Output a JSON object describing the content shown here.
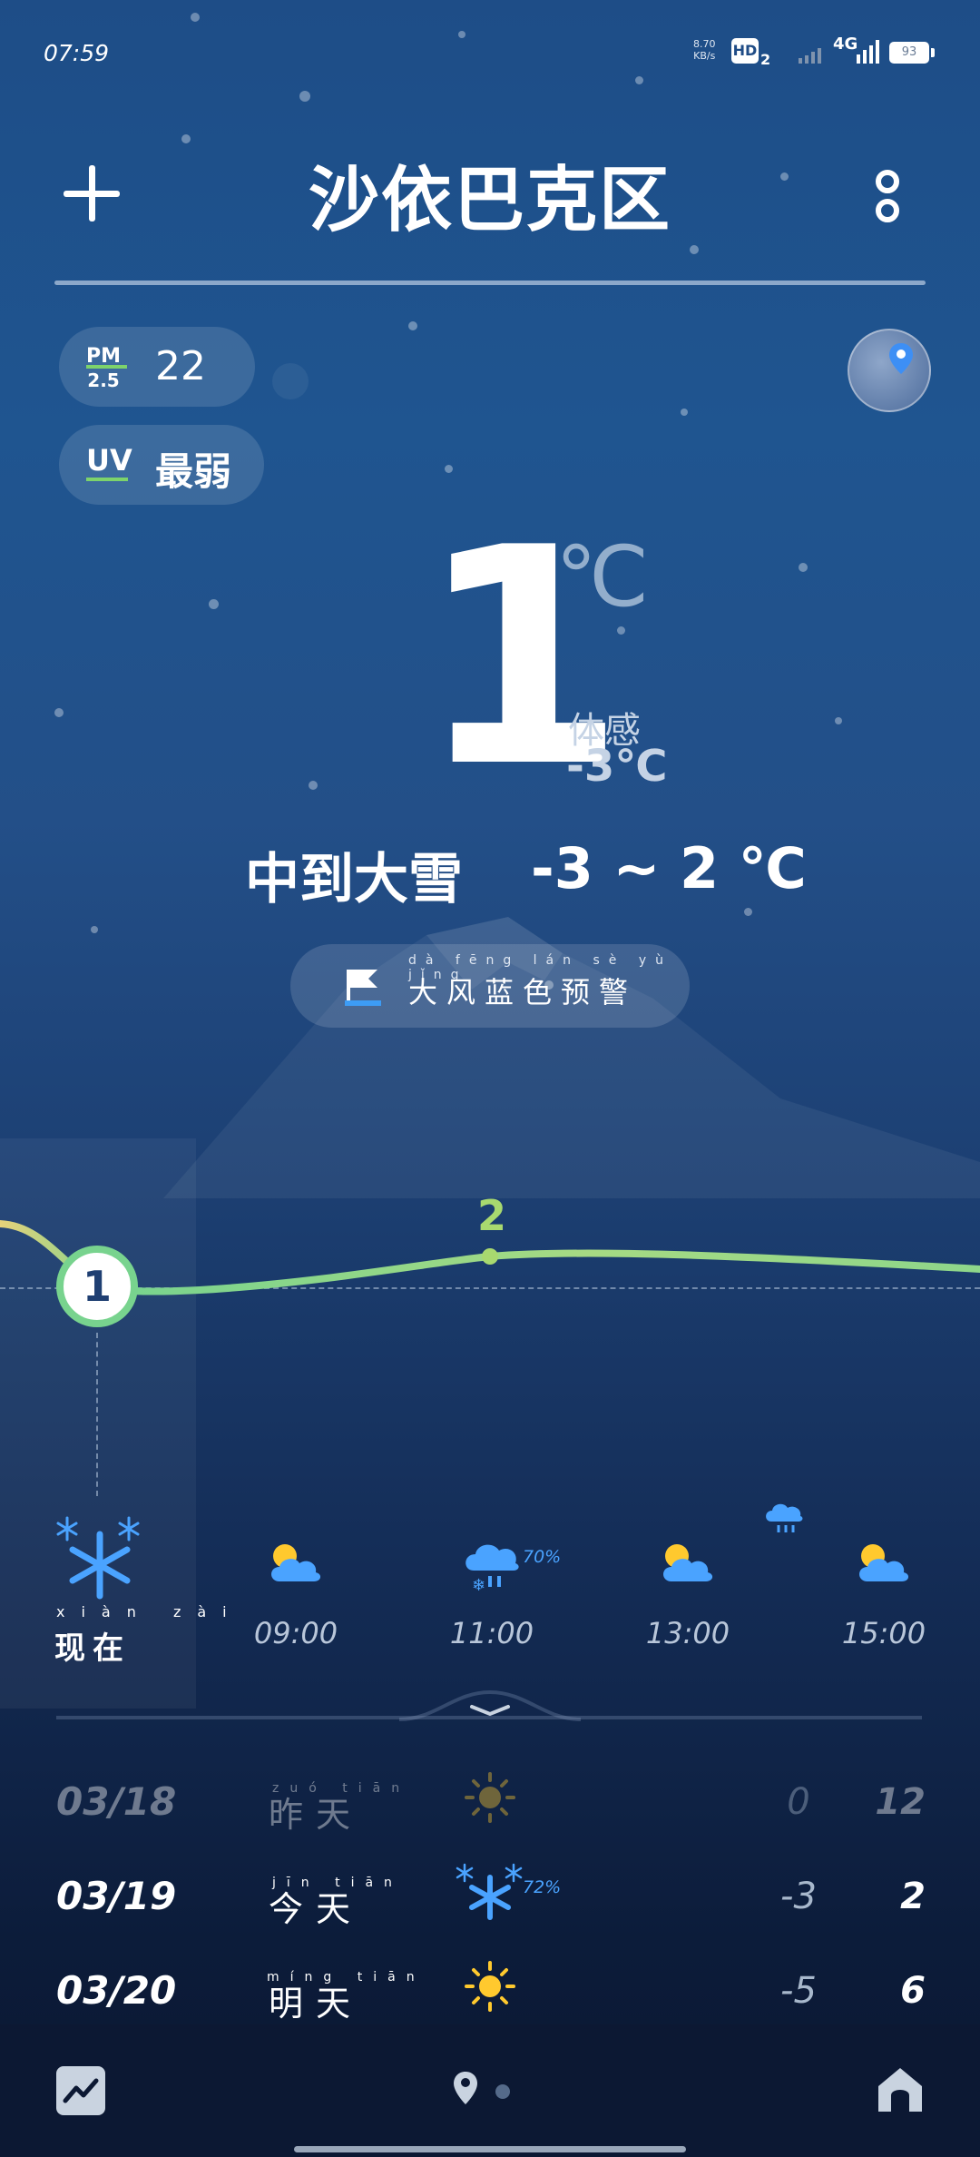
{
  "status_bar": {
    "time": "07:59",
    "net_speed_top": "8.70",
    "net_speed_unit": "KB/s",
    "hd": "HD",
    "hd_sub": "2",
    "network": "4G",
    "battery": "93"
  },
  "header": {
    "city": "沙依巴克区"
  },
  "air": {
    "pm_label_top": "PM",
    "pm_label_bottom": "2.5",
    "pm_value": "22",
    "uv_label": "UV",
    "uv_value": "最弱"
  },
  "current": {
    "temperature": "1",
    "unit": "℃",
    "feels_label": "体感",
    "feels_value": "-3℃",
    "condition": "中到大雪",
    "range": "-3 ~ 2 ℃"
  },
  "alert": {
    "text": "大风蓝色预警",
    "pinyin": "dà fēng lán sè yù jǐng"
  },
  "hourly": {
    "now_value": "1",
    "peak_value": "2",
    "now_label": "现在",
    "now_pinyin": "xiàn zài",
    "hours": [
      "09:00",
      "11:00",
      "13:00",
      "15:00"
    ],
    "precip_11": "70%",
    "temps": [
      2,
      1,
      1.1,
      1.4,
      2,
      2,
      1.95,
      1.9
    ]
  },
  "daily": [
    {
      "date": "03/18",
      "name": "昨天",
      "pinyin": "zuó tiān",
      "icon": "sun-icon",
      "low": "0",
      "high": "12"
    },
    {
      "date": "03/19",
      "name": "今天",
      "pinyin": "jīn tiān",
      "icon": "snow-icon",
      "low": "-3",
      "high": "2",
      "precip": "72%"
    },
    {
      "date": "03/20",
      "name": "明天",
      "pinyin": "míng tiān",
      "icon": "sun-icon",
      "low": "-5",
      "high": "6"
    }
  ],
  "colors": {
    "accent_green": "#78d38e",
    "rain_blue": "#4aa3ff",
    "sun_yellow": "#ffc92e"
  }
}
